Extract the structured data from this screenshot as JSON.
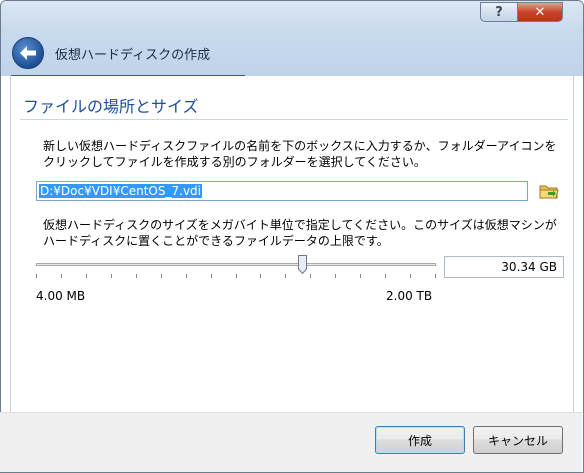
{
  "window": {
    "title": "仮想ハードディスクの作成",
    "help_glyph": "?",
    "close_glyph": "✕"
  },
  "section": {
    "heading": "ファイルの場所とサイズ",
    "location_desc": "新しい仮想ハードディスクファイルの名前を下のボックスに入力するか、フォルダーアイコンをクリックしてファイルを作成する別のフォルダーを選択してください。",
    "size_desc": "仮想ハードディスクのサイズをメガバイト単位で指定してください。このサイズは仮想マシンがハードディスクに置くことができるファイルデータの上限です。"
  },
  "path_input": {
    "value": "D:¥Doc¥VDI¥CentOS_7.vdi"
  },
  "size": {
    "value_text": "30.34 GB",
    "min_label": "4.00 MB",
    "max_label": "2.00 TB",
    "slider_fraction": 0.67
  },
  "buttons": {
    "create": "作成",
    "cancel": "キャンセル"
  },
  "colors": {
    "accent": "#1d4f9f",
    "selection": "#3399ff",
    "close": "#c8452c"
  },
  "icons": [
    "back-arrow-icon",
    "folder-icon",
    "help-icon",
    "close-icon"
  ]
}
